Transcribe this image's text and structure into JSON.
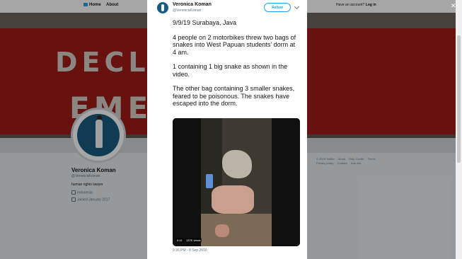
{
  "topbar": {
    "home_label": "Home",
    "about_label": "About",
    "account_prompt": "Have an account?",
    "login_label": "Log in"
  },
  "banner": {
    "line1": "DECL          MATE",
    "line2": "EME          ICY"
  },
  "profile": {
    "name": "Veronica Koman",
    "handle": "@VeronicaKoman",
    "bio": "human rights lawyer",
    "location": "Indonesia",
    "joined": "Joined January 2017"
  },
  "footer": {
    "links": [
      "© 2019 Twitter",
      "About",
      "Help Center",
      "Terms",
      "Privacy policy",
      "Cookies",
      "Ads info"
    ]
  },
  "tweet": {
    "name": "Veronica Koman",
    "handle": "@VeronicaKoman",
    "follow_label": "Follow",
    "paragraphs": [
      "9/9/19 Surabaya, Java",
      "4 people on 2 motorbikes threw two bags of snakes into West Papuan students’ dorm at 4 am.",
      "1 containing 1 big snake as shown in the video.",
      "The other bag containing 3 smaller snakes, feared to be poisonous. The snakes have escaped into the dorm."
    ],
    "video_time": "0:41",
    "video_views": "137K views",
    "date": "9:36 PM - 8 Sep 2019"
  }
}
